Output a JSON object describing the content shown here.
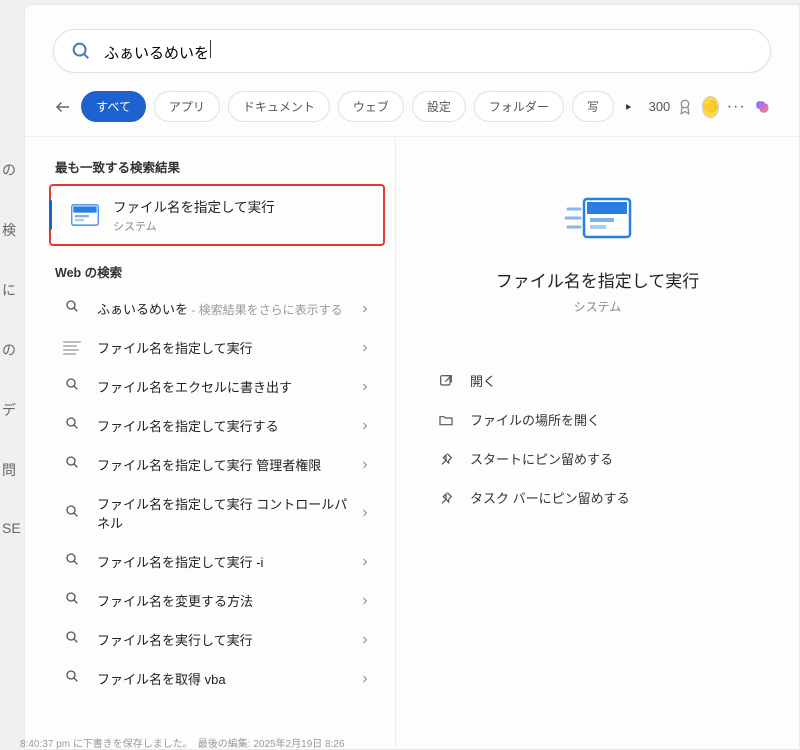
{
  "search": {
    "query": "ふぁいるめいを"
  },
  "filters": {
    "items": [
      "すべて",
      "アプリ",
      "ドキュメント",
      "ウェブ",
      "設定",
      "フォルダー",
      "写"
    ],
    "active_index": 0
  },
  "header": {
    "points": "300"
  },
  "sections": {
    "best_match": "最も一致する検索結果",
    "web": "Web の検索"
  },
  "best_match": {
    "title": "ファイル名を指定して実行",
    "subtitle": "システム"
  },
  "web_results": [
    {
      "icon": "search",
      "label": "ふぁいるめいを",
      "hint": " - 検索結果をさらに表示する"
    },
    {
      "icon": "lines",
      "label": "ファイル名を指定して実行",
      "hint": ""
    },
    {
      "icon": "search",
      "label": "ファイル名をエクセルに書き出す",
      "hint": ""
    },
    {
      "icon": "search",
      "label": "ファイル名を指定して実行する",
      "hint": ""
    },
    {
      "icon": "search",
      "label": "ファイル名を指定して実行 管理者権限",
      "hint": ""
    },
    {
      "icon": "search",
      "label": "ファイル名を指定して実行 コントロールパネル",
      "hint": ""
    },
    {
      "icon": "search",
      "label": "ファイル名を指定して実行 -i",
      "hint": ""
    },
    {
      "icon": "search",
      "label": "ファイル名を変更する方法",
      "hint": ""
    },
    {
      "icon": "search",
      "label": "ファイル名を実行して実行",
      "hint": ""
    },
    {
      "icon": "search",
      "label": "ファイル名を取得 vba",
      "hint": ""
    }
  ],
  "detail": {
    "title": "ファイル名を指定して実行",
    "subtitle": "システム",
    "actions": [
      {
        "icon": "open",
        "label": "開く"
      },
      {
        "icon": "folder",
        "label": "ファイルの場所を開く"
      },
      {
        "icon": "pin",
        "label": "スタートにピン留めする"
      },
      {
        "icon": "pin",
        "label": "タスク バーにピン留めする"
      }
    ]
  },
  "icons": {
    "search": "search-icon",
    "back": "back-arrow-icon",
    "overflow": "overflow-play-icon",
    "reward": "reward-ribbon-icon",
    "avatar": "user-avatar-icon",
    "more": "more-dots-icon",
    "copilot": "copilot-icon",
    "run": "run-dialog-icon",
    "chevron": "chevron-right-icon",
    "open": "open-external-icon",
    "folder": "folder-icon",
    "pin": "pin-icon"
  },
  "truncated_footer": "8:40:37 pm に下書きを保存しました。　最後の編集: 2025年2月19日 8:26"
}
